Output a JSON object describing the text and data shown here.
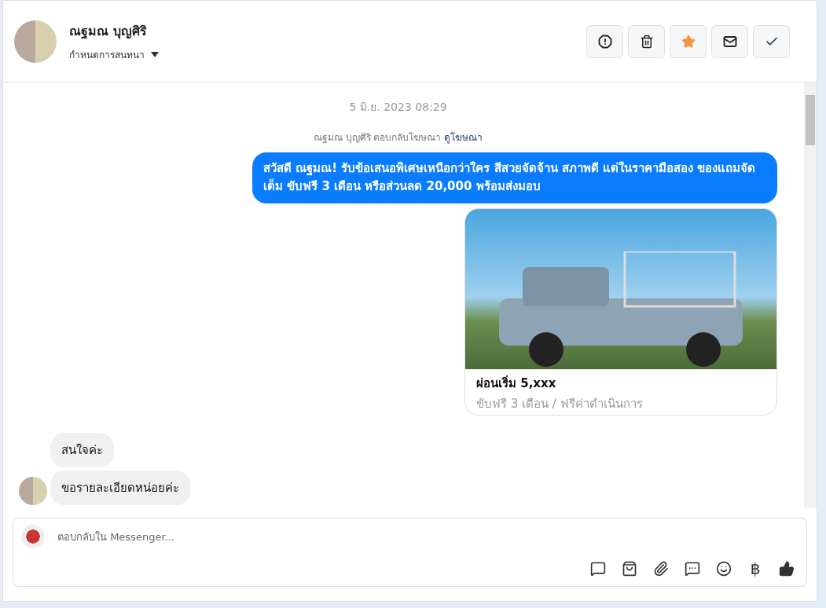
{
  "header": {
    "name": "ณฐมณ บุญศิริ",
    "assign_label": "กำหนดการสนทนา",
    "actions": [
      {
        "kind": "spam",
        "selected": false
      },
      {
        "kind": "delete",
        "selected": false
      },
      {
        "kind": "star",
        "selected": true
      },
      {
        "kind": "unread",
        "selected": false
      },
      {
        "kind": "done",
        "selected": false
      }
    ]
  },
  "conversation": {
    "timestamp": "5 มิ.ย. 2023 08:29",
    "ad_reply": {
      "text": "ณฐมณ บุญศิริ ตอบกลับโฆษณา",
      "link": "ดูโฆษณา"
    },
    "messages": [
      {
        "kind": "outgoing",
        "text": "สวัสดี ณฐมณ! รับข้อเสนอพิเศษเหนือกว่าใคร สีสวยจัดจ้าน สภาพดี แต่ในราคามือสอง ของแถมจัดเต็ม ขับฟรี 3 เดือน หรือส่วนลด 20,000 พร้อมส่งมอบ"
      },
      {
        "kind": "card",
        "title": "ผ่อนเริ่ม 5,xxx",
        "subtitle": "ขับฟรี 3 เดือน / ฟรีค่าดำเนินการ"
      },
      {
        "kind": "incoming",
        "text": "สนใจค่ะ",
        "avatar": false
      },
      {
        "kind": "incoming",
        "text": "ขอรายละเอียดหน่อยค่ะ",
        "avatar": true
      }
    ]
  },
  "composer": {
    "placeholder": "ตอบกลับใน Messenger...",
    "tools": [
      {
        "kind": "saved-reply"
      },
      {
        "kind": "shop"
      },
      {
        "kind": "attach"
      },
      {
        "kind": "chat"
      },
      {
        "kind": "emoji"
      },
      {
        "kind": "currency",
        "glyph": "฿"
      },
      {
        "kind": "like"
      }
    ]
  }
}
